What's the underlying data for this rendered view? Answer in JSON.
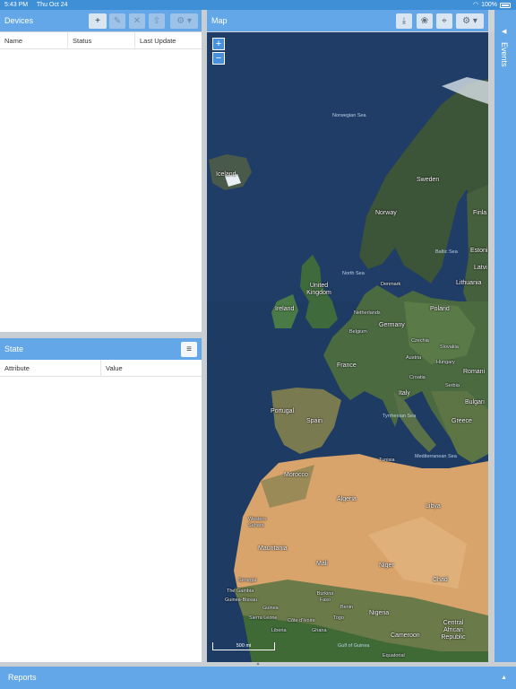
{
  "status_bar": {
    "time": "5:43 PM",
    "date": "Thu Oct 24",
    "battery": "100%"
  },
  "devices": {
    "title": "Devices",
    "columns": [
      "Name",
      "Status",
      "Last Update"
    ],
    "toolbar": {
      "add": "+",
      "edit": "✎",
      "remove": "✕",
      "upload": "⇧",
      "settings": "⚙ ▾"
    }
  },
  "state": {
    "title": "State",
    "columns": [
      "Attribute",
      "Value"
    ],
    "toolbar": {
      "menu": "≡"
    }
  },
  "map": {
    "title": "Map",
    "toolbar": {
      "download": "⤓",
      "paw": "❀",
      "locate": "⌖",
      "settings": "⚙ ▾"
    },
    "zoom_in": "+",
    "zoom_out": "−",
    "scale": "500 mi",
    "labels": {
      "norwegian_sea": "Norwegian Sea",
      "iceland": "Iceland",
      "sweden": "Sweden",
      "norway": "Norway",
      "finland": "Finla",
      "estonia": "Estoni",
      "baltic_sea": "Baltic Sea",
      "latvia": "Latvi",
      "north_sea": "North Sea",
      "denmark": "Denmark",
      "lithuania": "Lithuania",
      "united_kingdom": "United Kingdom",
      "ireland": "Ireland",
      "netherlands": "Netherlands",
      "poland": "Poland",
      "belgium": "Belgium",
      "germany": "Germany",
      "czechia": "Czechia",
      "slovakia": "Slovakia",
      "austria": "Austria",
      "france": "France",
      "hungary": "Hungary",
      "romania": "Romani",
      "croatia": "Croatia",
      "serbia": "Serbia",
      "italy": "Italy",
      "bulgaria": "Bulgari",
      "portugal": "Portugal",
      "spain": "Spain",
      "tyrrhenian_sea": "Tyrrhenian Sea",
      "greece": "Greece",
      "tunisia": "Tunisia",
      "mediterranean_sea": "Mediterranean Sea",
      "morocco": "Morocco",
      "algeria": "Algeria",
      "libya": "Libya",
      "western_sahara": "Western Sahara",
      "mauritania": "Mauritania",
      "mali": "Mali",
      "niger": "Niger",
      "chad": "Chad",
      "senegal": "Senegal",
      "the_gambia": "The Gambia",
      "guinea_bissau": "Guinea-Bissau",
      "guinea": "Guinea",
      "burkina_faso": "Burkina Faso",
      "benin": "Benin",
      "sierra_leone": "Sierra Leone",
      "cote_divoire": "Côte d'Ivoire",
      "togo": "Togo",
      "nigeria": "Nigeria",
      "liberia": "Liberia",
      "ghana": "Ghana",
      "central_african_republic": "Central African Republic",
      "cameroon": "Cameroon",
      "gulf_of_guinea": "Gulf of Guinea",
      "equatorial": "Equatorial"
    }
  },
  "events": {
    "title": "Events",
    "arrow": "◀"
  },
  "reports": {
    "title": "Reports",
    "arrow": "▲"
  },
  "colors": {
    "header": "#64a7e8",
    "status_bar": "#3f8fd6",
    "ocean": "#1f3d66",
    "desert": "#d9a46c",
    "land": "#3f5a3a"
  }
}
